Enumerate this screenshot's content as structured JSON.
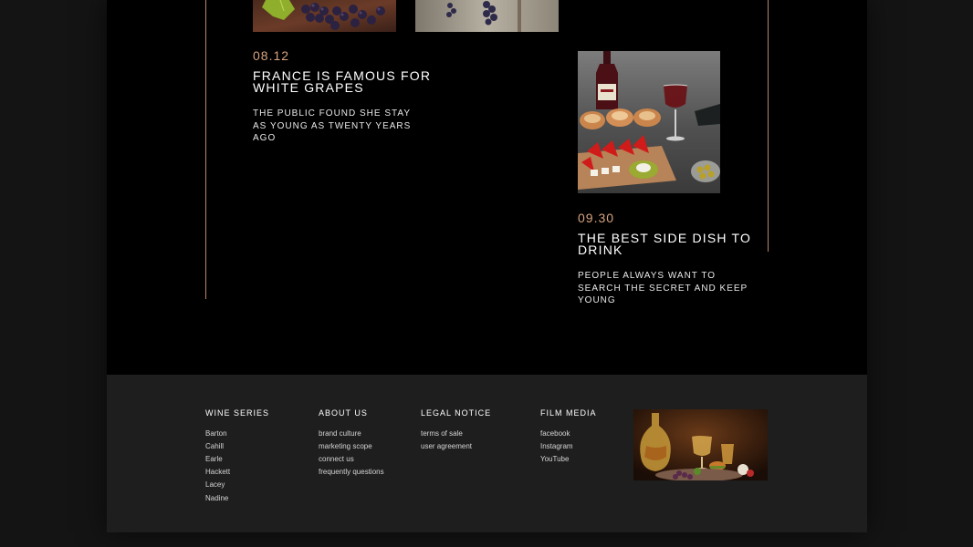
{
  "posts": [
    {
      "date": "08.12",
      "title_lines": [
        "FRANCE IS FAMOUS FOR",
        "WHITE GRAPES"
      ],
      "desc_lines": [
        "THE PUBLIC FOUND SHE STAY",
        "AS YOUNG AS TWENTY YEARS",
        "AGO"
      ]
    },
    {
      "date": "09.30",
      "title_lines": [
        "THE BEST SIDE DISH TO",
        "DRINK"
      ],
      "desc_lines": [
        "PEOPLE ALWAYS WANT TO",
        "SEARCH THE SECRET AND KEEP",
        "YOUNG"
      ]
    }
  ],
  "footer": {
    "columns": [
      {
        "heading": "WINE SERIES",
        "links": [
          "Barton",
          "Cahill",
          "Earle",
          "Hackett",
          "Lacey",
          "Nadine"
        ]
      },
      {
        "heading": "ABOUT US",
        "links": [
          "brand culture",
          "marketing scope",
          "connect us",
          "frequently questions"
        ]
      },
      {
        "heading": "LEGAL NOTICE",
        "links": [
          "terms of sale",
          "user agreement"
        ]
      },
      {
        "heading": "FILM MEDIA",
        "links": [
          "facebook",
          "Instagram",
          "YouTube"
        ]
      }
    ]
  },
  "colors": {
    "accent": "#d6a27e",
    "line": "#b9876a",
    "background": "#000000",
    "footer_bg": "#1e1e1e"
  }
}
